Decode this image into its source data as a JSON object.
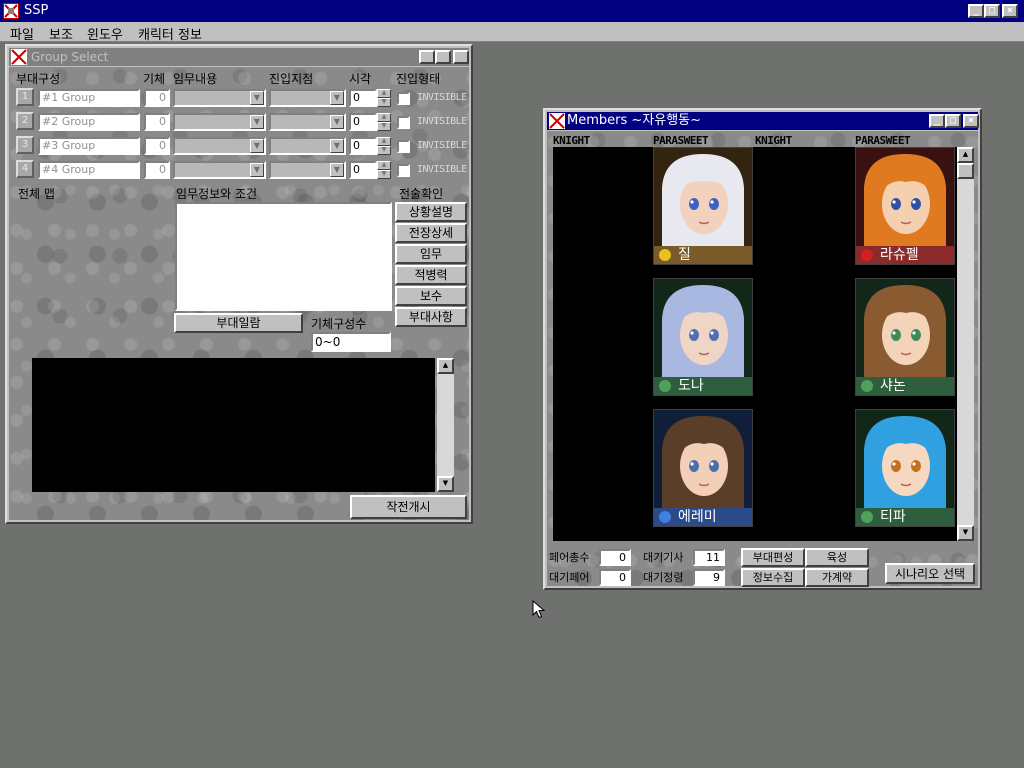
{
  "app": {
    "title": "SSP",
    "menu": [
      "파일",
      "보조",
      "윈도우",
      "캐릭터 정보"
    ]
  },
  "group_select": {
    "title": "Group Select",
    "headers": {
      "unit": "부대구성",
      "count": "기체",
      "mission": "임무내용",
      "entry_point": "진입지점",
      "time": "시각",
      "entry_type": "진입형태"
    },
    "rows": [
      {
        "num": "1",
        "name": "#1 Group",
        "count": "0",
        "time": "0",
        "type": "INVISIBLE"
      },
      {
        "num": "2",
        "name": "#2 Group",
        "count": "0",
        "time": "0",
        "type": "INVISIBLE"
      },
      {
        "num": "3",
        "name": "#3 Group",
        "count": "0",
        "time": "0",
        "type": "INVISIBLE"
      },
      {
        "num": "4",
        "name": "#4 Group",
        "count": "0",
        "time": "0",
        "type": "INVISIBLE"
      }
    ],
    "full_map_label": "전체 맵",
    "mission_info_label": "임무정보와 조건",
    "briefing_label": "전술확인",
    "side_buttons": [
      "상황설명",
      "전장상세",
      "임무",
      "적병력",
      "보수",
      "부대사항"
    ],
    "unit_list_button": "부대일람",
    "unit_count_label": "기체구성수",
    "unit_count_value": "0~0",
    "start_button": "작전개시"
  },
  "members": {
    "title": "Members ~자유행동~",
    "columns": [
      "KNIGHT",
      "PARASWEET",
      "KNIGHT",
      "PARASWEET"
    ],
    "characters": [
      {
        "name": "질",
        "element": "thunder",
        "color": "#7a5a28",
        "hair": "#e8e8f0",
        "skin": "#f2d2bc",
        "eyes": "#4060c0"
      },
      {
        "name": "라슈펠",
        "element": "fire",
        "color": "#8a2a2a",
        "hair": "#e07a20",
        "skin": "#f4d0b0",
        "eyes": "#3050a0"
      },
      {
        "name": "도나",
        "element": "wood",
        "color": "#2e5e3e",
        "hair": "#a8b8e0",
        "skin": "#f0d4c4",
        "eyes": "#5070b0"
      },
      {
        "name": "샤논",
        "element": "wood",
        "color": "#2e5e3e",
        "hair": "#8a5a30",
        "skin": "#f4d4b8",
        "eyes": "#3e8a5a"
      },
      {
        "name": "에레미",
        "element": "water",
        "color": "#2a4a8a",
        "hair": "#5a3e28",
        "skin": "#f2d0b8",
        "eyes": "#4a70a8"
      },
      {
        "name": "티파",
        "element": "wood",
        "color": "#2e5e3e",
        "hair": "#30a0e0",
        "skin": "#f6d8c0",
        "eyes": "#c07020"
      }
    ],
    "stats": [
      {
        "label": "페어총수",
        "value": "0"
      },
      {
        "label": "대기페어",
        "value": "0"
      },
      {
        "label": "대기기사",
        "value": "11"
      },
      {
        "label": "대기정령",
        "value": "9"
      }
    ],
    "buttons": {
      "unit_edit": "부대편성",
      "training": "육성",
      "info_collect": "정보수집",
      "contract": "가계약",
      "scenario": "시나리오 선택"
    }
  }
}
